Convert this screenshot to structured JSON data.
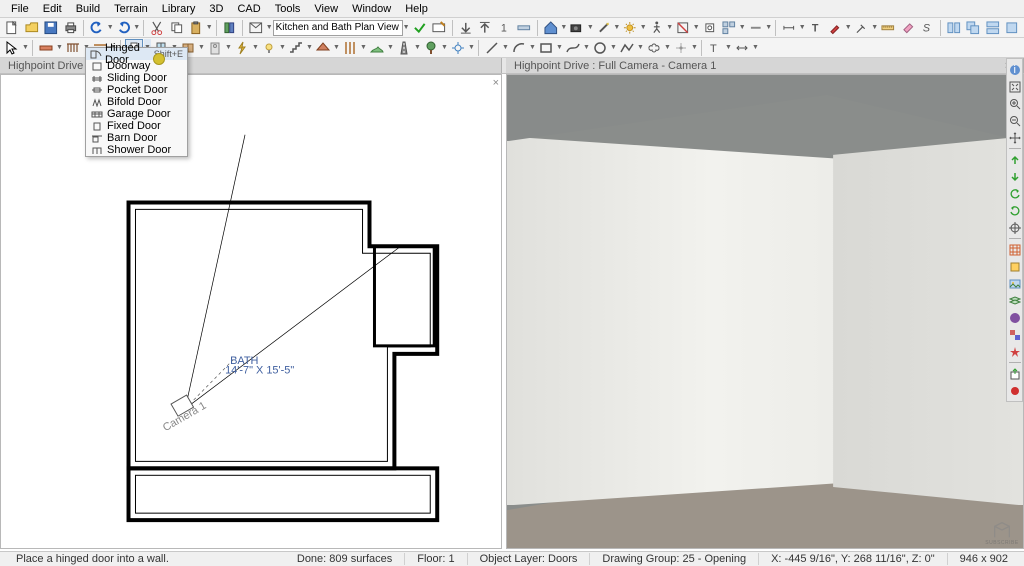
{
  "menu": {
    "items": [
      "File",
      "Edit",
      "Build",
      "Terrain",
      "Library",
      "3D",
      "CAD",
      "Tools",
      "View",
      "Window",
      "Help"
    ]
  },
  "toolbar2": {
    "viewDropdown": "Kitchen and Bath Plan View"
  },
  "tabs": {
    "left": "Highpoint Drive : Kitchen an",
    "right": "Highpoint Drive : Full Camera - Camera 1"
  },
  "doorMenu": {
    "items": [
      {
        "label": "Hinged Door",
        "shortcut": "Shift+E",
        "highlighted": true
      },
      {
        "label": "Doorway"
      },
      {
        "label": "Sliding Door"
      },
      {
        "label": "Pocket Door"
      },
      {
        "label": "Bifold Door"
      },
      {
        "label": "Garage Door"
      },
      {
        "label": "Fixed Door"
      },
      {
        "label": "Barn Door"
      },
      {
        "label": "Shower Door"
      }
    ]
  },
  "plan": {
    "roomLabel": "BATH",
    "roomDims": "14'-7\" X 15'-5\"",
    "cameraLabel": "Camera 1"
  },
  "status": {
    "hint": "Place a hinged door into a wall.",
    "done": "Done: 809 surfaces",
    "floor": "Floor: 1",
    "layer": "Object Layer: Doors",
    "group": "Drawing Group: 25 - Opening",
    "coords": "X: -445 9/16\", Y: 268 11/16\", Z: 0\"",
    "size": "946 x 902"
  },
  "logo": {
    "text": "SUBSCRIBE"
  }
}
